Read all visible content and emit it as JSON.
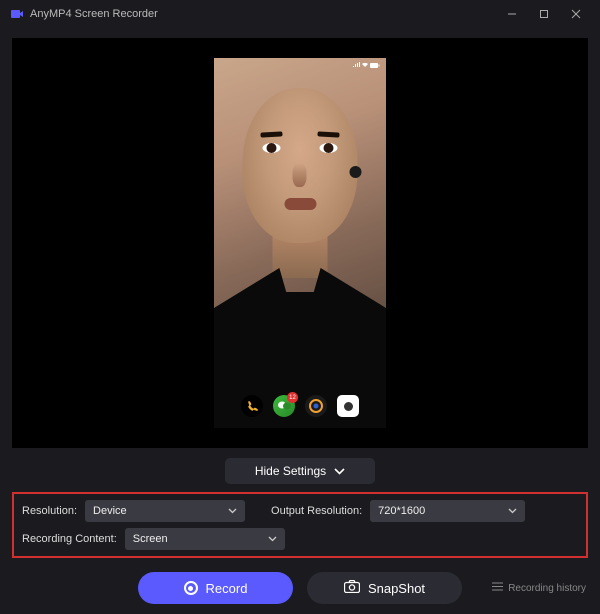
{
  "app": {
    "title": "AnyMP4 Screen Recorder"
  },
  "phone": {
    "time": "",
    "badge": "12"
  },
  "controls": {
    "hide_settings": "Hide Settings",
    "resolution_label": "Resolution:",
    "resolution_value": "Device",
    "output_label": "Output Resolution:",
    "output_value": "720*1600",
    "recording_content_label": "Recording Content:",
    "recording_content_value": "Screen"
  },
  "actions": {
    "record": "Record",
    "snapshot": "SnapShot",
    "history": "Recording history"
  }
}
